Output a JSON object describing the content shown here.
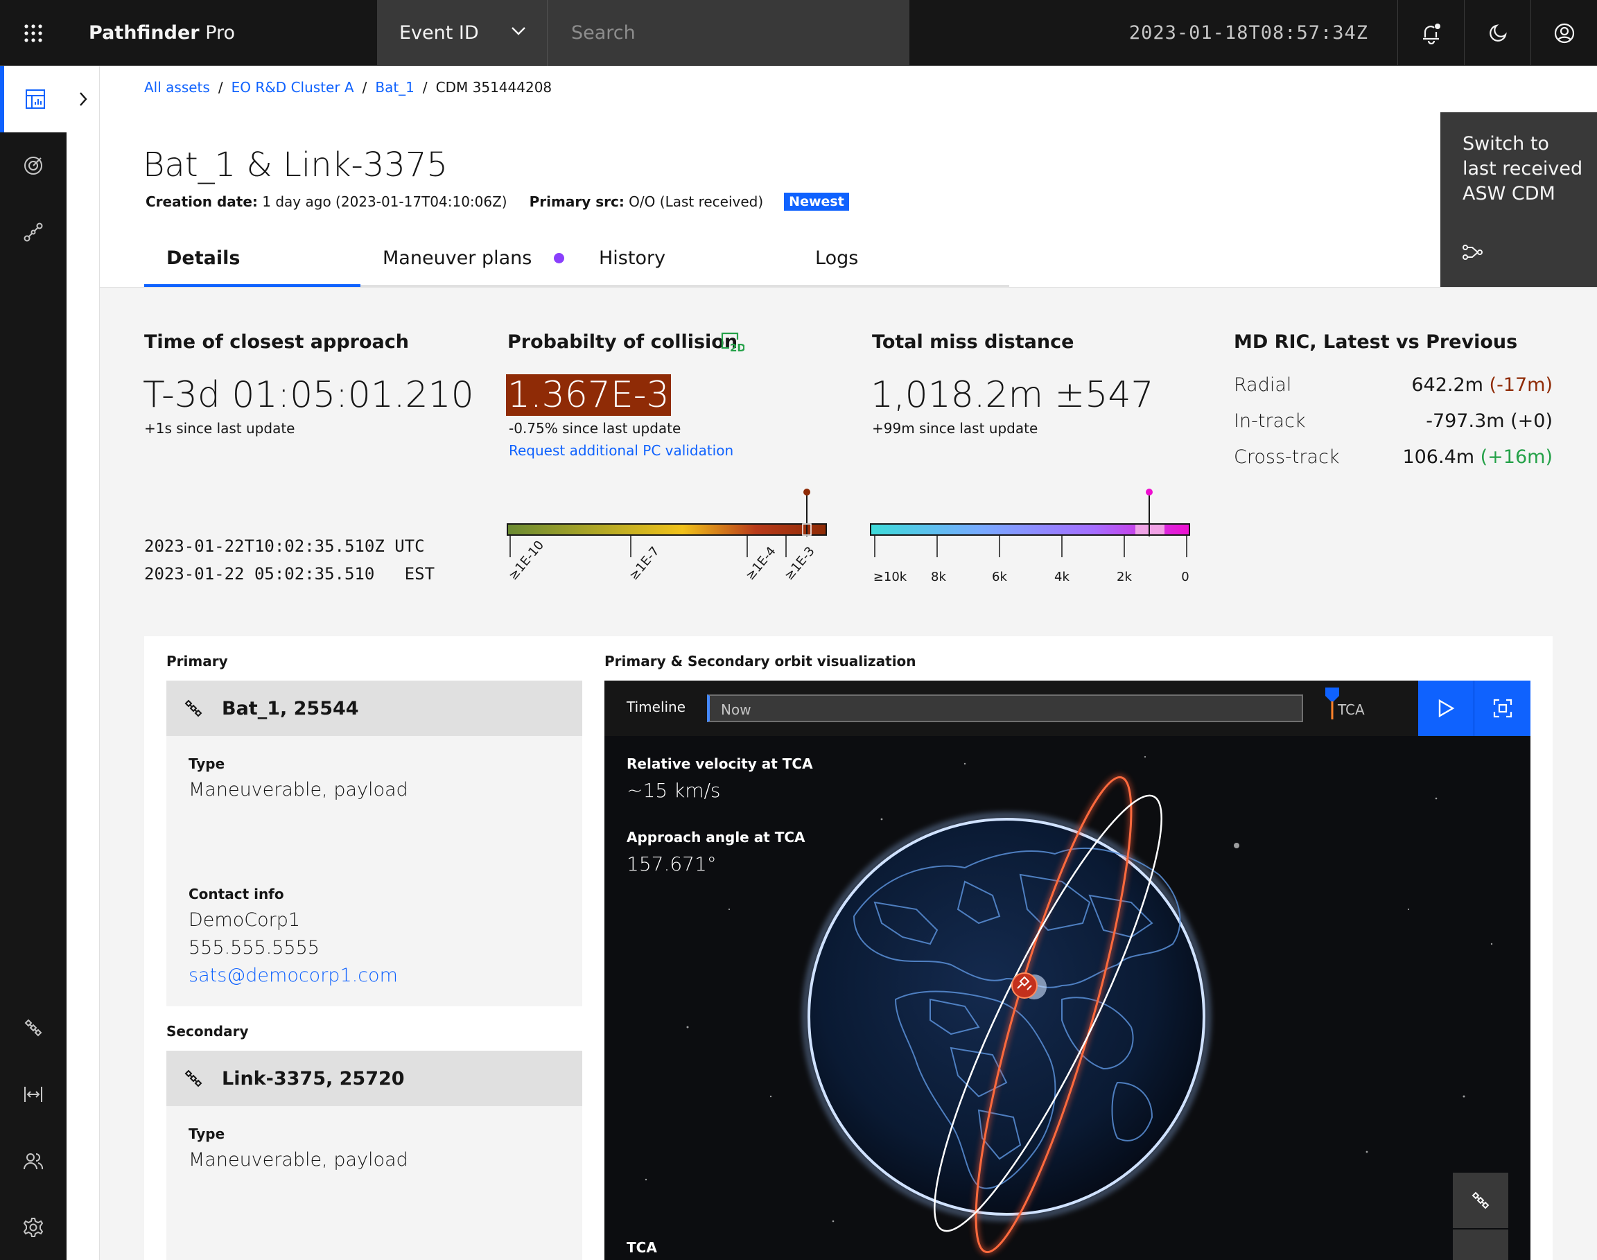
{
  "header": {
    "brand_bold": "Pathfinder",
    "brand_light": " Pro",
    "event_id_label": "Event ID",
    "search_placeholder": "Search",
    "clock": "2023-01-18T08:57:34Z"
  },
  "breadcrumb": {
    "items": [
      "All assets",
      "EO R&D Cluster A",
      "Bat_1"
    ],
    "current": "CDM 351444208"
  },
  "page": {
    "title": "Bat_1 & Link-3375",
    "creation_label": "Creation date:",
    "creation_value": " 1 day ago (2023-01-17T04:10:06Z)",
    "src_label": "Primary src:",
    "src_value": " O/O (Last received)",
    "badge": "Newest"
  },
  "tabs": [
    {
      "label": "Details",
      "active": true
    },
    {
      "label": "Maneuver plans",
      "active": false
    },
    {
      "label": "History",
      "active": false
    },
    {
      "label": "Logs",
      "active": false
    }
  ],
  "switch_panel": {
    "line1": "Switch to",
    "line2": "last received",
    "line3": "ASW CDM"
  },
  "metrics": {
    "tca": {
      "title": "Time of closest approach",
      "value": "T-3d 01:05:01.210",
      "delta": "+1s since last update",
      "utc": "2023-01-22T10:02:35.510Z UTC",
      "est": "2023-01-22 05:02:35.510   EST"
    },
    "pc": {
      "title": "Probabilty of collision",
      "value": "1.367E-3",
      "delta": "-0.75% since last update",
      "link": "Request additional PC validation",
      "scale_ticks": [
        "≥1E-10",
        "≥1E-7",
        "≥1E-4",
        "≥1E-3"
      ],
      "marker_fraction": 0.94,
      "colors": [
        "#6a8a32",
        "#f1c21b",
        "#8f2b06"
      ]
    },
    "miss": {
      "title": "Total miss distance",
      "value": "1,018.2m ±547",
      "delta": "+99m since last update",
      "scale_ticks": [
        "≥10k",
        "8k",
        "6k",
        "4k",
        "2k",
        "0"
      ],
      "marker_fraction": 0.88,
      "colors": [
        "#3ddbd9",
        "#a56eff",
        "#ee0fd0"
      ]
    },
    "ric": {
      "title": "MD RIC, Latest vs Previous",
      "rows": [
        {
          "label": "Radial",
          "value": "642.2m ",
          "change": "(-17m)",
          "trend": "neg"
        },
        {
          "label": "In-track",
          "value": "-797.3m ",
          "change": "(+0)",
          "trend": "neutral"
        },
        {
          "label": "Cross-track",
          "value": "106.4m ",
          "change": "(+16m)",
          "trend": "pos"
        }
      ]
    }
  },
  "primary": {
    "section_label": "Primary",
    "name": "Bat_1, 25544",
    "type_label": "Type",
    "type_value": "Maneuverable, payload",
    "contact_label": "Contact info",
    "contact_company": "DemoCorp1",
    "contact_phone": "555.555.5555",
    "contact_email": "sats@democorp1.com"
  },
  "secondary": {
    "section_label": "Secondary",
    "name": "Link-3375, 25720",
    "type_label": "Type",
    "type_value": "Maneuverable, payload"
  },
  "viz": {
    "title": "Primary & Secondary orbit visualization",
    "timeline_label": "Timeline",
    "now_label": "Now",
    "tca_label": "TCA",
    "velocity_label": "Relative velocity at TCA",
    "velocity_value": "~15 km/s",
    "angle_label": "Approach angle at TCA",
    "angle_value": "157.671°",
    "timeline_position": 0.97,
    "bottom_cut_label": "TCA"
  }
}
